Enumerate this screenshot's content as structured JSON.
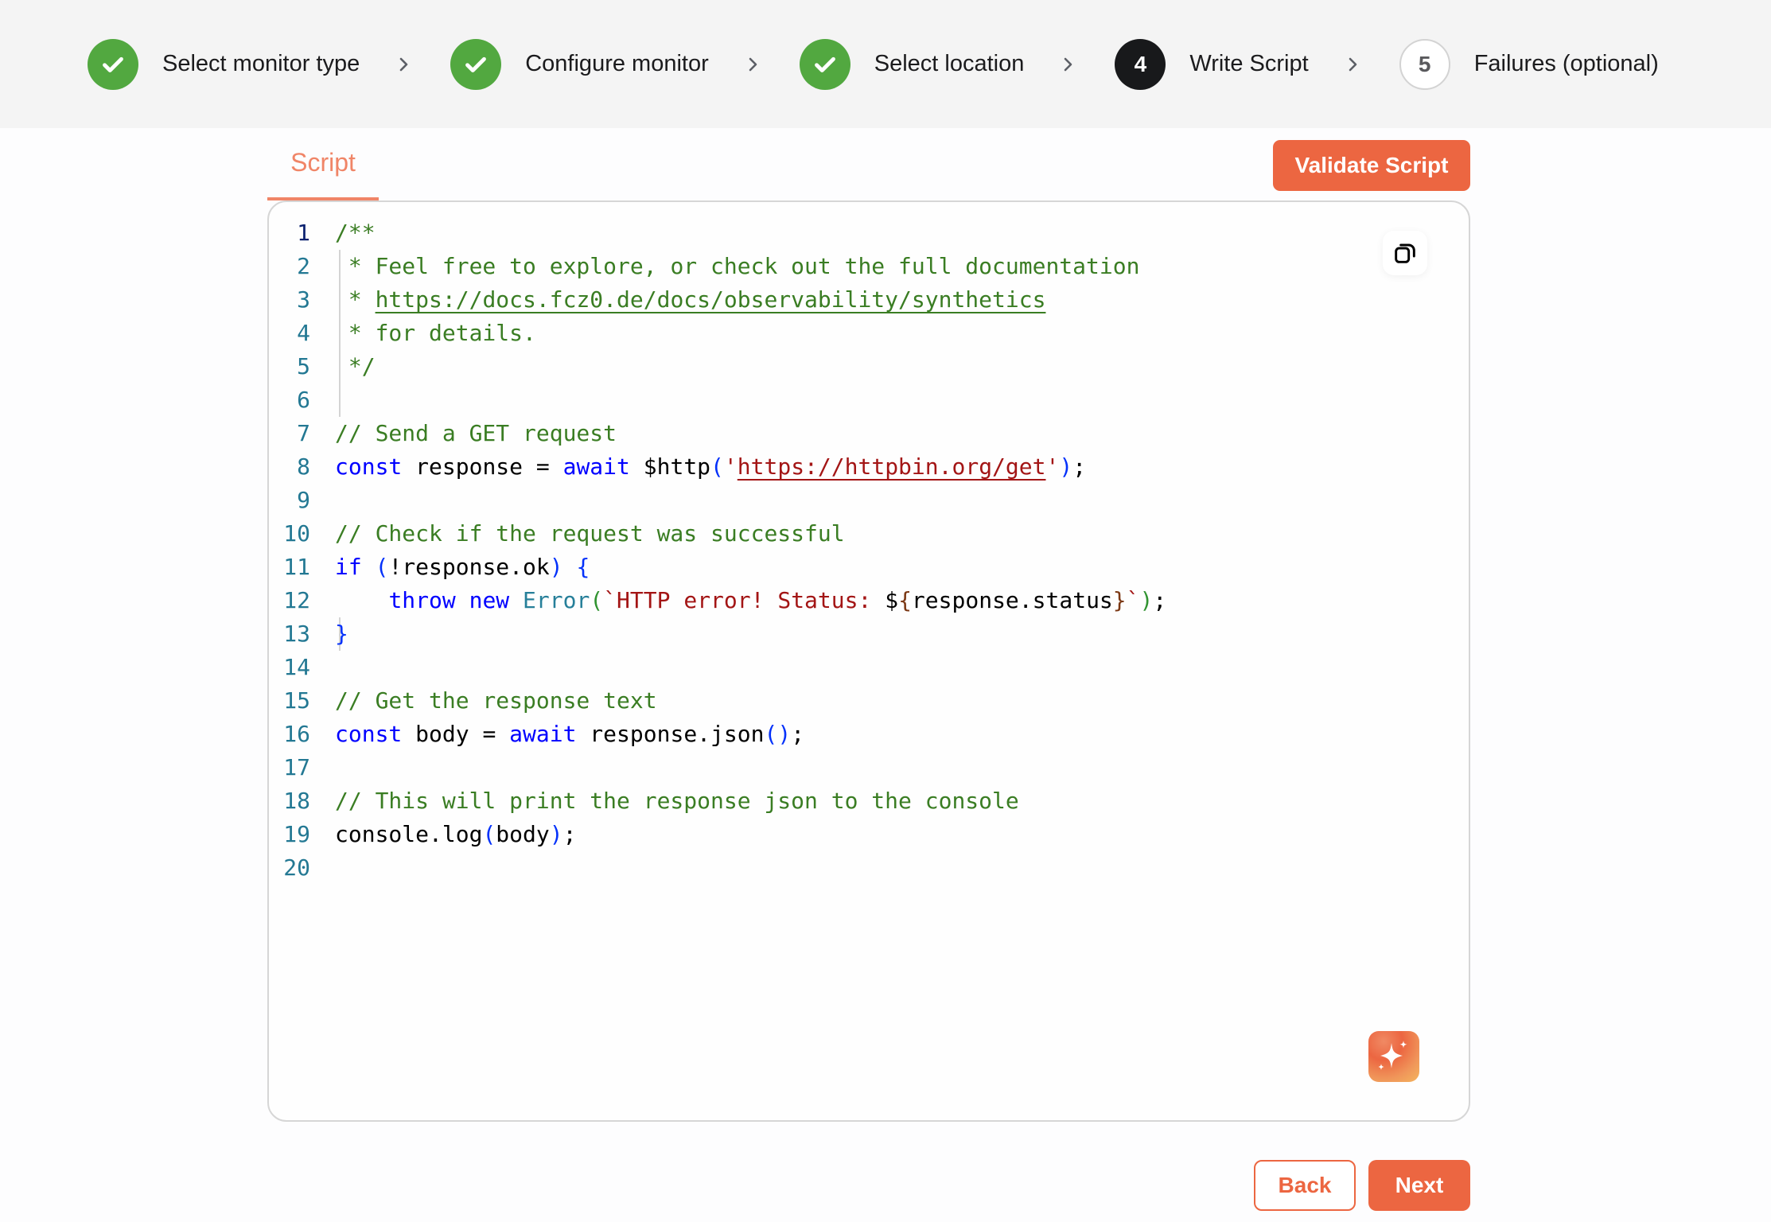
{
  "stepper": {
    "steps": [
      {
        "label": "Select monitor type",
        "status": "completed",
        "icon": "check-icon"
      },
      {
        "label": "Configure monitor",
        "status": "completed",
        "icon": "check-icon"
      },
      {
        "label": "Select location",
        "status": "completed",
        "icon": "check-icon"
      },
      {
        "label": "Write Script",
        "status": "active",
        "number": "4"
      },
      {
        "label": "Failures (optional)",
        "status": "pending",
        "number": "5"
      }
    ],
    "separator_icon": "chevron-right-icon"
  },
  "tabs": {
    "active": "Script",
    "items": [
      {
        "label": "Script"
      }
    ]
  },
  "toolbar": {
    "validate_label": "Validate Script"
  },
  "editor": {
    "language": "javascript",
    "active_line": 1,
    "copy_icon": "copy-icon",
    "ai_icon": "sparkles-icon",
    "lines": [
      "/**",
      " * Feel free to explore, or check out the full documentation",
      " * https://docs.fcz0.de/docs/observability/synthetics",
      " * for details.",
      " */",
      "",
      "// Send a GET request",
      "const response = await $http('https://httpbin.org/get');",
      "",
      "// Check if the request was successful",
      "if (!response.ok) {",
      "    throw new Error(`HTTP error! Status: ${response.status}`);",
      "}",
      "",
      "// Get the response text",
      "const body = await response.json();",
      "",
      "// This will print the response json to the console",
      "console.log(body);",
      ""
    ],
    "tokens": {
      "l1": "/**",
      "l2": "* Feel free to explore, or check out the full documentation",
      "l3_star": "* ",
      "l3_link": "https://docs.fcz0.de/docs/observability/synthetics",
      "l4": "* for details.",
      "l5": "*/",
      "l7": "// Send a GET request",
      "l8_const": "const",
      "l8_name": " response = ",
      "l8_await": "await",
      "l8_fn": " $http",
      "l8_open": "(",
      "l8_q1": "'",
      "l8_url": "https://httpbin.org/get",
      "l8_q2": "'",
      "l8_close": ")",
      "l8_semi": ";",
      "l10": "// Check if the request was successful",
      "l11_if": "if",
      "l11_sp": " ",
      "l11_open": "(",
      "l11_cond": "!response.ok",
      "l11_close": ")",
      "l11_sp2": " ",
      "l11_brace": "{",
      "l12_indent": "    ",
      "l12_throw": "throw",
      "l12_sp": " ",
      "l12_new": "new",
      "l12_sp2": " ",
      "l12_class": "Error",
      "l12_open": "(",
      "l12_str": "`HTTP error! Status: ",
      "l12_dollar": "$",
      "l12_tplo": "{",
      "l12_expr": "response.status",
      "l12_tplc": "}",
      "l12_tick": "`",
      "l12_close": ")",
      "l12_semi": ";",
      "l13": "}",
      "l15": "// Get the response text",
      "l16_const": "const",
      "l16_name": " body = ",
      "l16_await": "await",
      "l16_call": " response.json",
      "l16_parens": "()",
      "l16_semi": ";",
      "l18": "// This will print the response json to the console",
      "l19_call": "console.log",
      "l19_open": "(",
      "l19_arg": "body",
      "l19_close": ")",
      "l19_semi": ";"
    }
  },
  "footer": {
    "back_label": "Back",
    "next_label": "Next"
  },
  "colors": {
    "brand": "#ec6641",
    "step_completed": "#52a840",
    "step_active": "#18191b",
    "comment": "#3a7d23",
    "keyword": "#0000ff",
    "string": "#a31515",
    "class": "#267f99"
  }
}
